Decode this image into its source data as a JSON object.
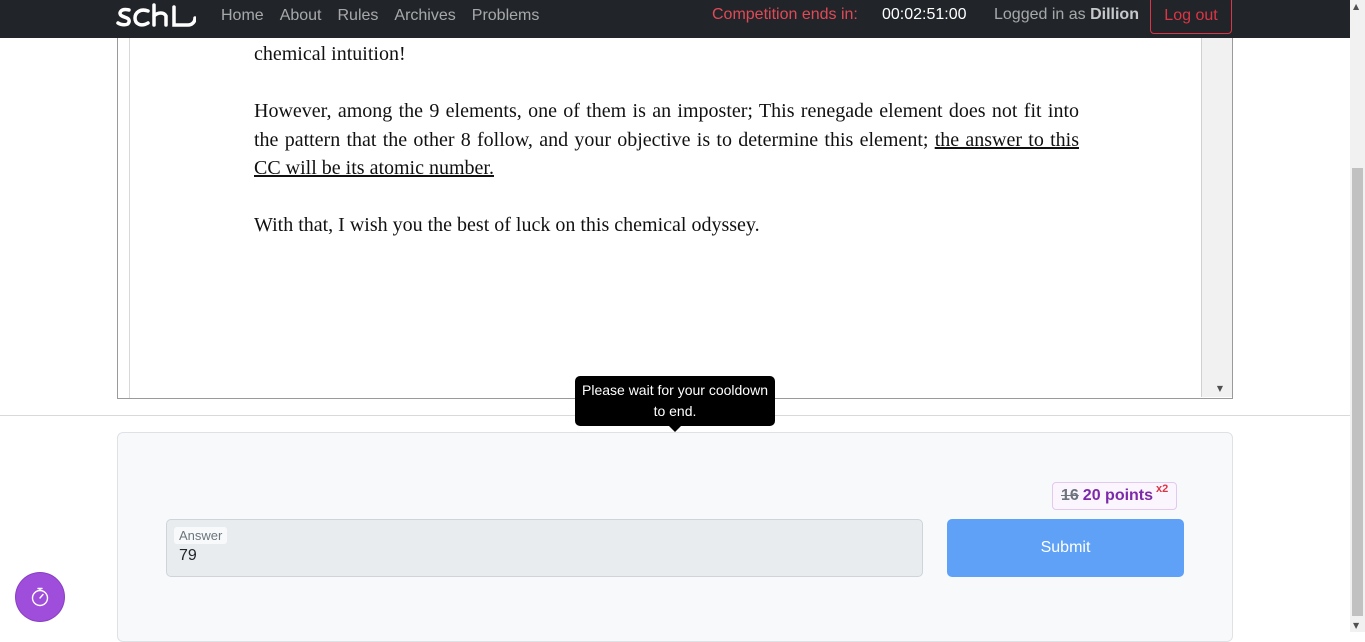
{
  "navbar": {
    "brand": "SCHL",
    "links": [
      "Home",
      "About",
      "Rules",
      "Archives",
      "Problems"
    ],
    "timer_label": "Competition ends in:",
    "timer_value": "00:02:51:00",
    "logged_in_prefix": "Logged in as",
    "username": "Dillion",
    "logout_label": "Log out"
  },
  "document": {
    "line_intro": "chemical intuition!",
    "para_imposter_plain": "However, among the 9 elements, one of them is an imposter; This renegade element does not fit into the pattern that the other 8 follow, and your objective is to determine this element; ",
    "para_imposter_underlined": "the answer to this CC will be its atomic number.",
    "para_closing": "With that, I wish you the best of luck on this chemical odyssey."
  },
  "tooltip": {
    "text": "Please wait for your cooldown to end."
  },
  "answer_section": {
    "points_old": "16",
    "points_new": "20 points",
    "multiplier": "x2",
    "answer_label": "Answer",
    "answer_value": "79",
    "submit_label": "Submit"
  },
  "colors": {
    "navbar_bg": "#212529",
    "timer_red": "#e04a57",
    "submit_blue": "#5ea1f7",
    "points_purple": "#7b2aa8",
    "fab_purple": "#9f4ddb"
  },
  "icons": {
    "fab": "stopwatch-icon"
  }
}
